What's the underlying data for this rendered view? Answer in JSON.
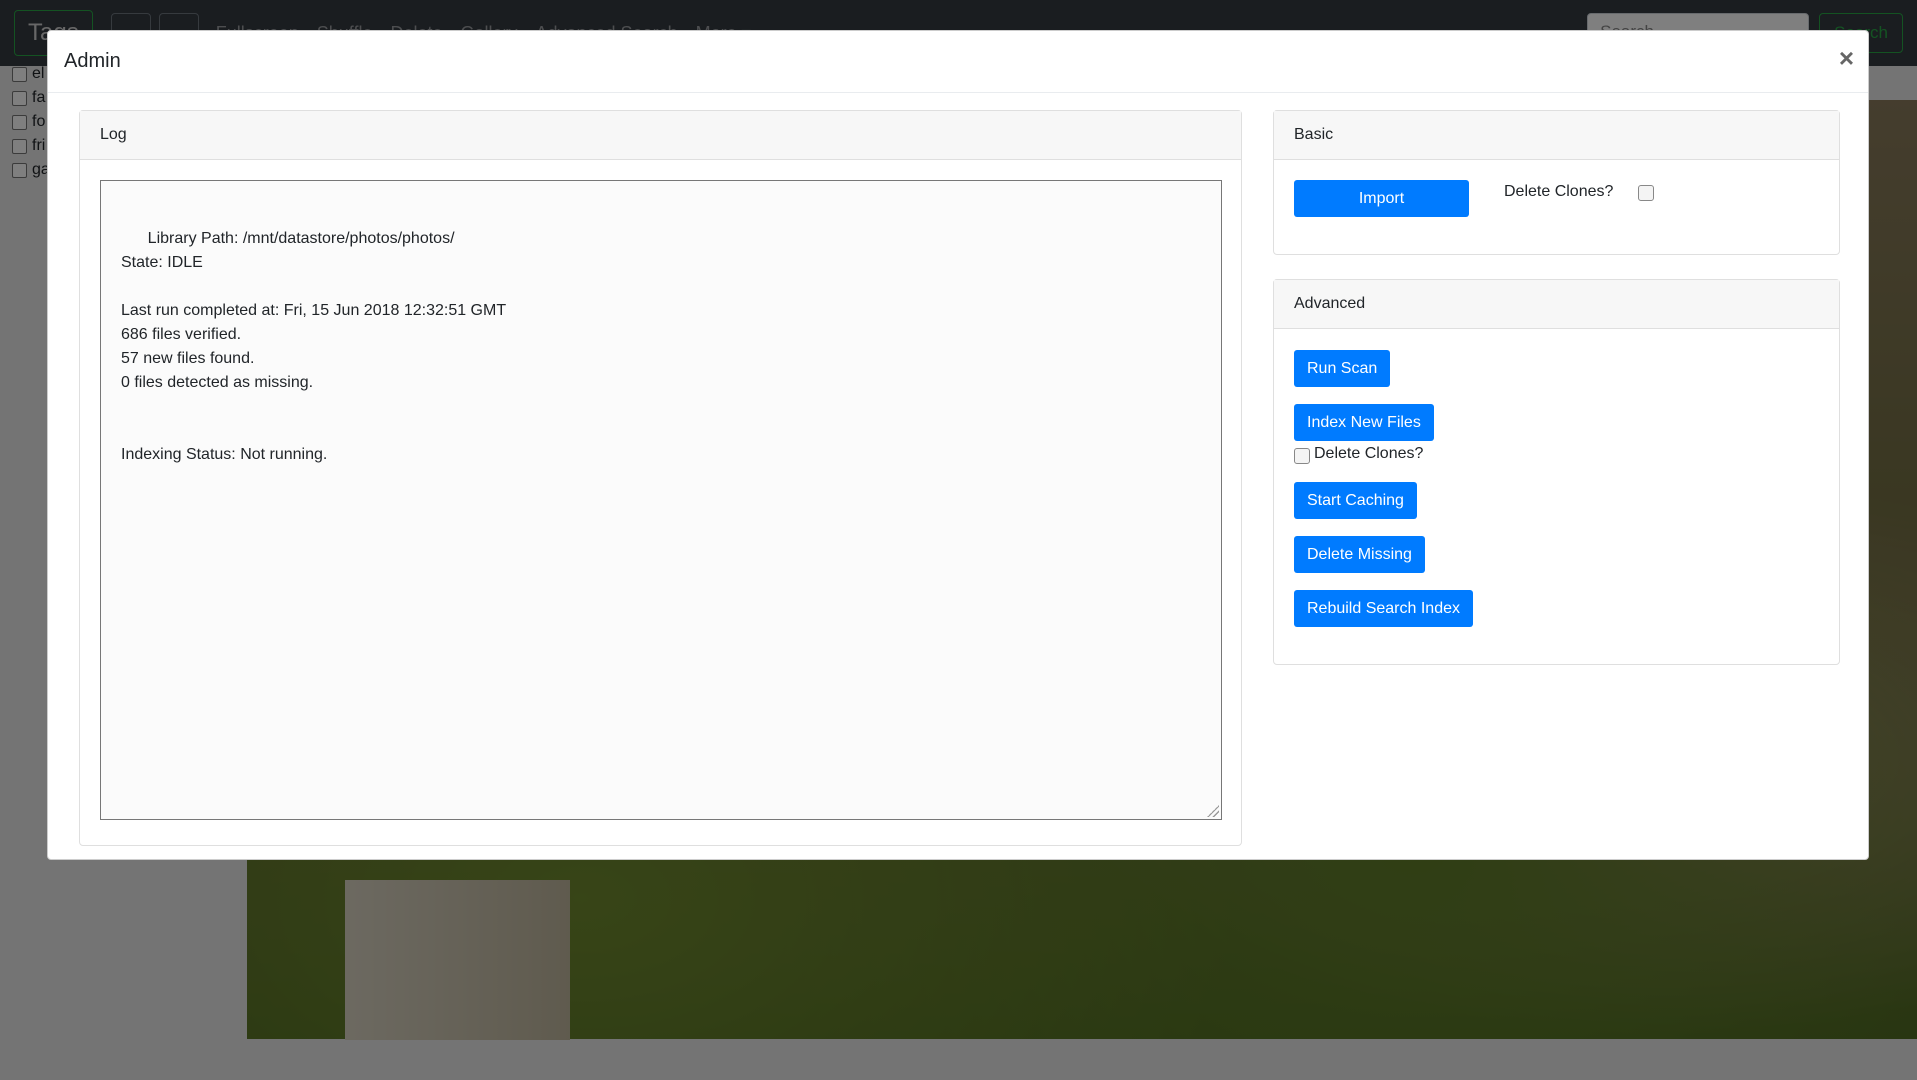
{
  "navbar": {
    "tags_label": "Tags",
    "links": [
      "Fullscreen",
      "Shuffle",
      "Delete",
      "Gallery",
      "Advanced Search",
      "More ▾"
    ],
    "search_placeholder": "Search",
    "search_button": "Search"
  },
  "tags": [
    "el",
    "fa",
    "fo",
    "fri",
    "ga"
  ],
  "modal": {
    "title": "Admin",
    "close_label": "×"
  },
  "log": {
    "header": "Log",
    "text": "Library Path: /mnt/datastore/photos/photos/\nState: IDLE\n\nLast run completed at: Fri, 15 Jun 2018 12:32:51 GMT\n686 files verified.\n57 new files found.\n0 files detected as missing.\n\n\nIndexing Status: Not running."
  },
  "basic": {
    "header": "Basic",
    "import_label": "Import",
    "delete_clones_label": "Delete Clones?"
  },
  "advanced": {
    "header": "Advanced",
    "run_scan_label": "Run Scan",
    "index_new_files_label": "Index New Files",
    "delete_clones_label": "Delete Clones?",
    "start_caching_label": "Start Caching",
    "delete_missing_label": "Delete Missing",
    "rebuild_search_index_label": "Rebuild Search Index"
  },
  "colors": {
    "primary": "#007bff",
    "navbar": "#343a40",
    "success": "#28a745"
  }
}
